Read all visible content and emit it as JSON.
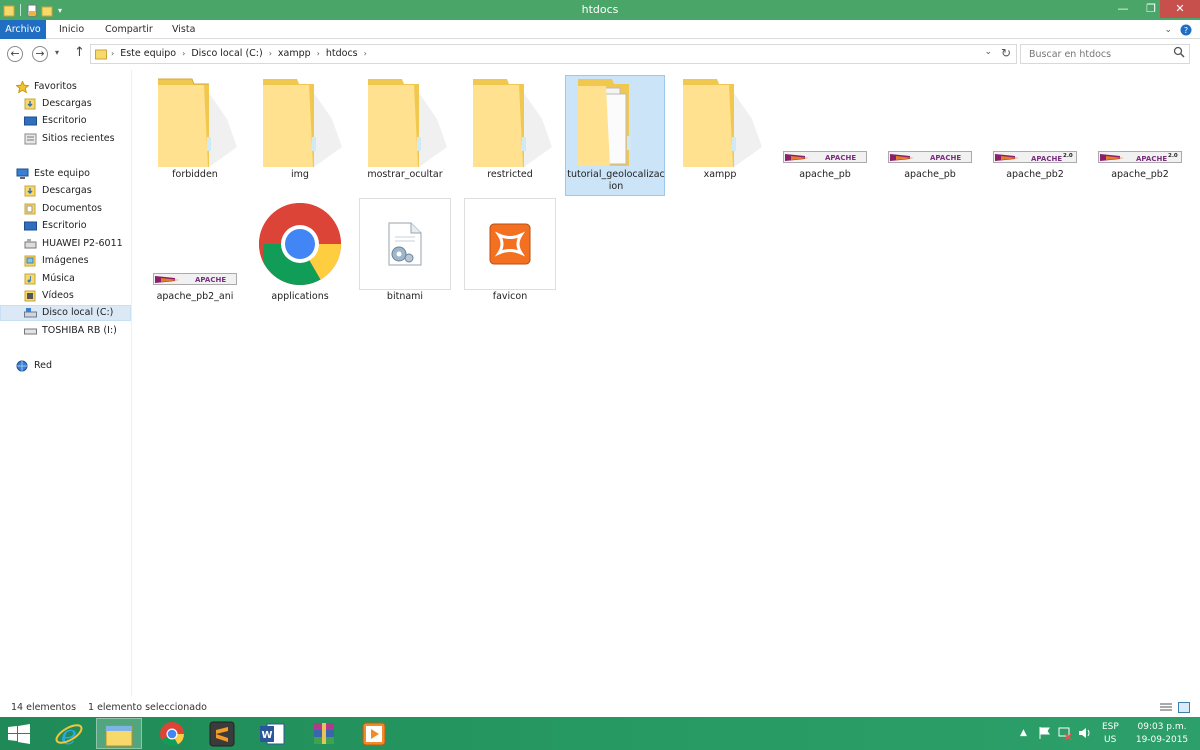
{
  "window": {
    "title": "htdocs",
    "min_glyph": "—",
    "max_glyph": "❐",
    "close_glyph": "✕"
  },
  "ribbon": {
    "tabs": [
      {
        "label": "Archivo",
        "active": true
      },
      {
        "label": "Inicio"
      },
      {
        "label": "Compartir"
      },
      {
        "label": "Vista"
      }
    ]
  },
  "address": {
    "breadcrumbs": [
      "Este equipo",
      "Disco local (C:)",
      "xampp",
      "htdocs"
    ],
    "search_placeholder": "Buscar en htdocs"
  },
  "sidebar": {
    "favorites": {
      "label": "Favoritos",
      "items": [
        "Descargas",
        "Escritorio",
        "Sitios recientes"
      ]
    },
    "computer": {
      "label": "Este equipo",
      "items": [
        "Descargas",
        "Documentos",
        "Escritorio",
        "HUAWEI P2-6011",
        "Imágenes",
        "Música",
        "Vídeos",
        "Disco local (C:)",
        "TOSHIBA RB (I:)"
      ]
    },
    "network": {
      "label": "Red"
    }
  },
  "items": [
    {
      "name": "forbidden",
      "type": "folder"
    },
    {
      "name": "img",
      "type": "folder"
    },
    {
      "name": "mostrar_ocultar",
      "type": "folder"
    },
    {
      "name": "restricted",
      "type": "folder"
    },
    {
      "name": "tutorial_geolocalizacion",
      "type": "folder",
      "selected": true
    },
    {
      "name": "xampp",
      "type": "folder"
    },
    {
      "name": "apache_pb",
      "type": "image",
      "banner_text": "APACHE"
    },
    {
      "name": "apache_pb",
      "type": "image",
      "banner_text": "APACHE"
    },
    {
      "name": "apache_pb2",
      "type": "image",
      "banner_text": "APACHE",
      "version": "2.0"
    },
    {
      "name": "apache_pb2",
      "type": "image",
      "banner_text": "APACHE",
      "version": "2.0"
    },
    {
      "name": "apache_pb2_ani",
      "type": "image",
      "banner_text": "APACHE"
    },
    {
      "name": "applications",
      "type": "chrome-html"
    },
    {
      "name": "bitnami",
      "type": "config-file"
    },
    {
      "name": "favicon",
      "type": "xampp-icon"
    }
  ],
  "status": {
    "count": "14 elementos",
    "selection": "1 elemento seleccionado"
  },
  "taskbar": {
    "apps": [
      "windows-start",
      "internet-explorer",
      "file-explorer",
      "chrome",
      "sublime-text",
      "word",
      "winrar",
      "media-player"
    ],
    "lang_top": "ESP",
    "lang_bottom": "US",
    "time": "09:03 p.m.",
    "date": "19-09-2015"
  },
  "colors": {
    "titlebar": "#4aa569",
    "archivo_tab": "#1f6ec2",
    "selection": "#cce4f7",
    "taskbar": "#279a63"
  }
}
